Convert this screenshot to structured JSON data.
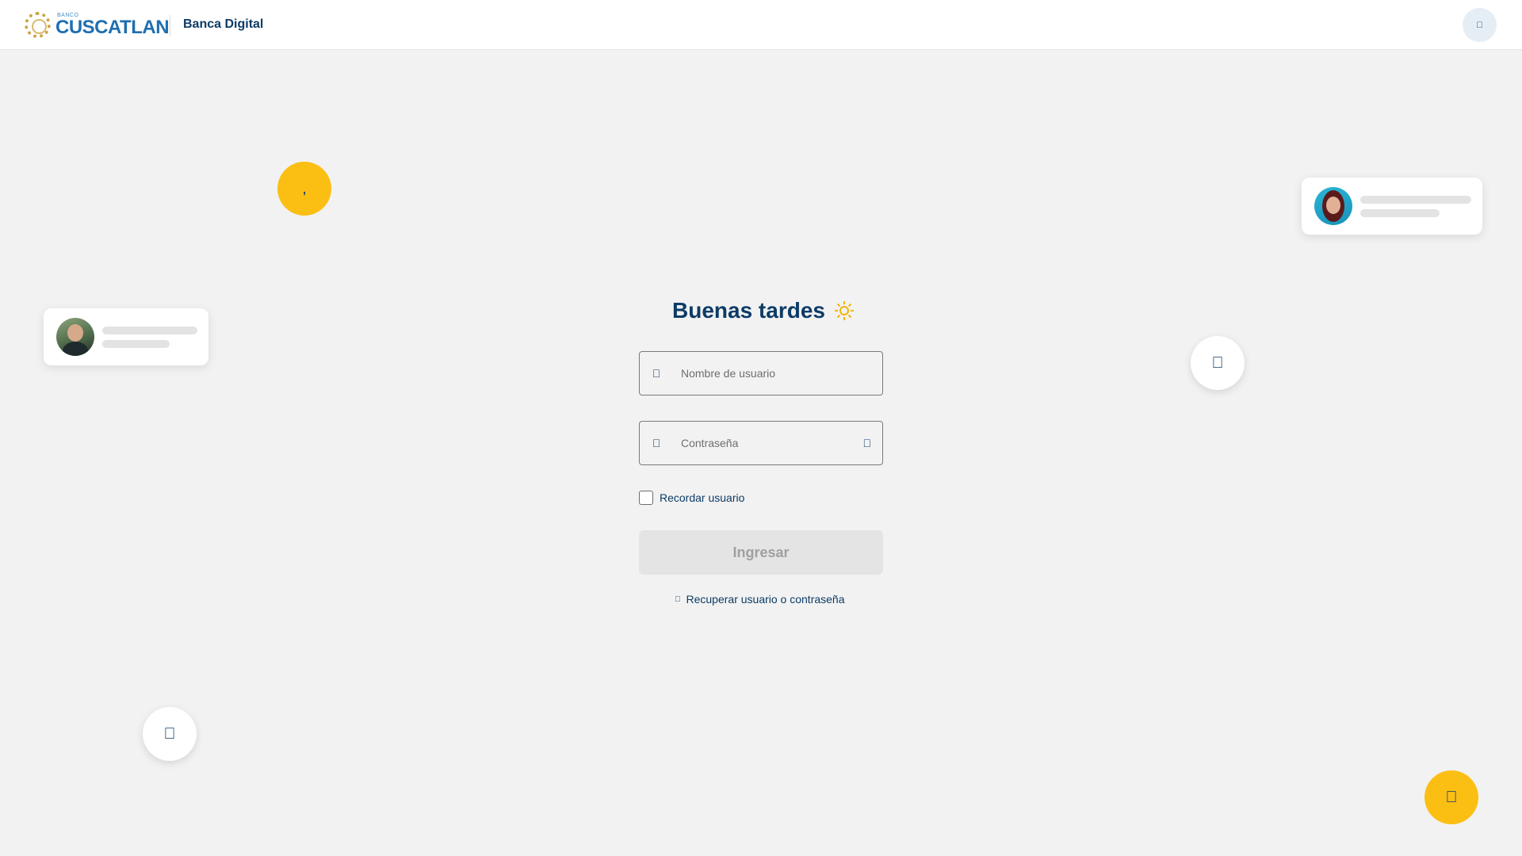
{
  "header": {
    "logo_small": "BANCO",
    "logo_name": "CUSCATLAN",
    "title": "Banca Digital",
    "help_icon": "info-icon"
  },
  "decor": {
    "yellow_bubble_top_glyph": ",",
    "right_bubble_icon": "lock-icon",
    "left_bubble_icon": "lock-icon",
    "bottom_bubble_icon": "wallet-icon"
  },
  "login": {
    "greeting": "Buenas tardes",
    "greeting_icon": "sun-icon",
    "username_placeholder": "Nombre de usuario",
    "username_icon": "user-icon",
    "password_placeholder": "Contraseña",
    "password_icon": "lock-icon",
    "show_password_icon": "eye-icon",
    "remember_label": "Recordar usuario",
    "remember_checked": false,
    "submit_label": "Ingresar",
    "recover_label": "Recuperar usuario o contraseña",
    "recover_icon": "key-icon"
  },
  "colors": {
    "primary": "#0d3b66",
    "accent": "#fbbf14",
    "background": "#f2f2f2"
  }
}
